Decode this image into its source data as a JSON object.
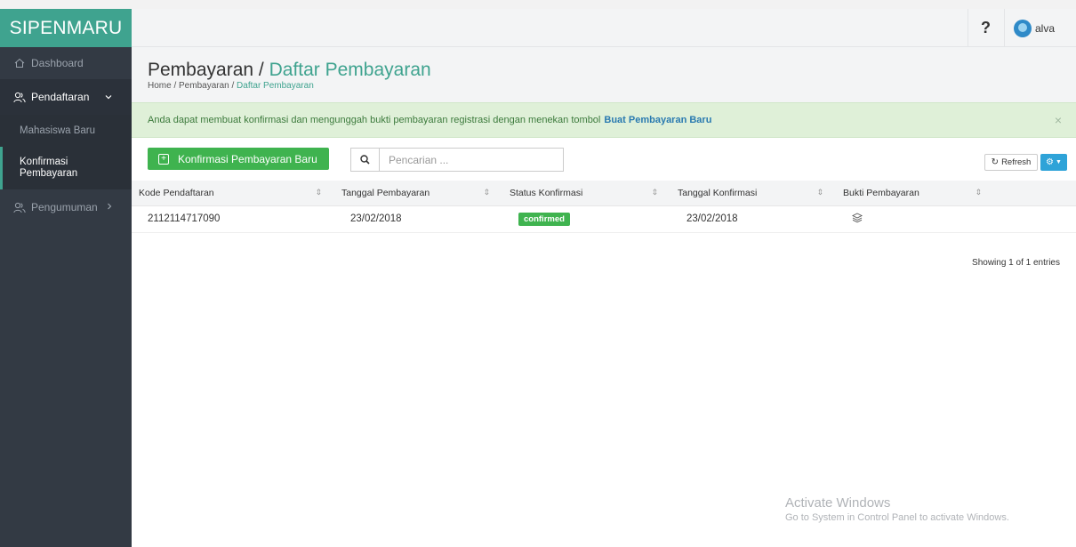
{
  "app": {
    "brand": "SIPENMARU",
    "user_name": "alva",
    "help_icon": "question-icon"
  },
  "sidebar": {
    "dashboard": "Dashboard",
    "pendaftaran": "Pendaftaran",
    "mahasiswa_baru": "Mahasiswa Baru",
    "konfirmasi_pembayaran_line1": "Konfirmasi",
    "konfirmasi_pembayaran_line2": "Pembayaran",
    "pengumuman": "Pengumuman"
  },
  "page": {
    "title_main": "Pembayaran /",
    "title_accent": "Daftar Pembayaran",
    "breadcrumb_home": "Home / Pembayaran /",
    "breadcrumb_current": "Daftar Pembayaran"
  },
  "alert": {
    "text": "Anda dapat membuat konfirmasi dan mengunggah bukti pembayaran registrasi dengan menekan tombol",
    "bold": "Buat Pembayaran Baru",
    "close": "×"
  },
  "toolbar": {
    "new_button": "Konfirmasi Pembayaran Baru",
    "search_placeholder": "Pencarian ...",
    "refresh": "Refresh"
  },
  "table": {
    "headers": [
      "Kode Pendaftaran",
      "Tanggal Pembayaran",
      "Status Konfirmasi",
      "Tanggal Konfirmasi",
      "Bukti Pembayaran"
    ],
    "rows": [
      {
        "kode": "2112114717090",
        "tanggal_pembayaran": "23/02/2018",
        "status": "confirmed",
        "tanggal_konfirmasi": "23/02/2018",
        "bukti_icon": "layers-icon"
      }
    ],
    "showing": "Showing 1 of 1 entries"
  },
  "watermark": {
    "title": "Activate Windows",
    "subtitle": "Go to System in Control Panel to activate Windows."
  },
  "colors": {
    "sidebar_bg": "#333a44",
    "brand_bg": "#3fa38f",
    "accent": "#3fa38f",
    "success": "#3fb34f",
    "info": "#2ea3d8",
    "alert_bg": "#dff0d8"
  }
}
